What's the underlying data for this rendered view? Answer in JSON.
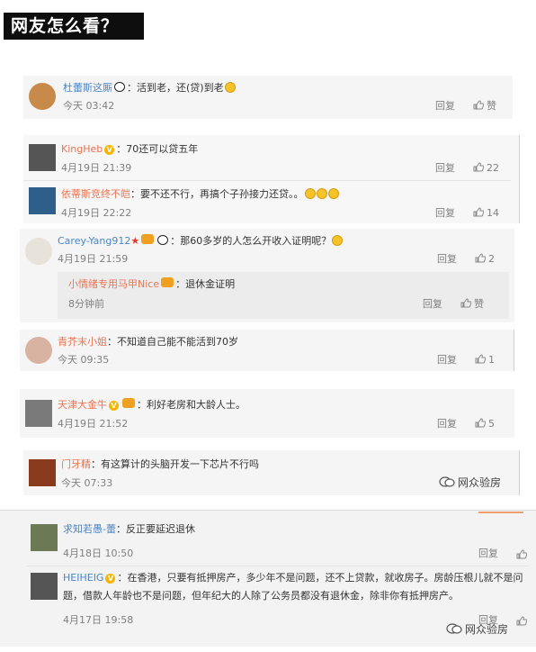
{
  "header": {
    "title": "网友怎么看？"
  },
  "comments": [
    {
      "user": "杜蕾斯这厮",
      "text": "：活到老，还(贷)到老",
      "time": "今天 03:42",
      "reply": "回复",
      "likes": "赞"
    },
    {
      "user": "KingHeb",
      "text": "：70还可以贷五年",
      "time": "4月19日 21:39",
      "reply": "回复",
      "likes": "22"
    },
    {
      "user": "依蒂斯竞终不皑",
      "text": "：要不还不行，再搞个子孙接力还贷。。",
      "time": "4月19日 22:22",
      "reply": "回复",
      "likes": "14"
    },
    {
      "user": "Carey-Yang912",
      "text": "：那60多岁的人怎么开收入证明呢？",
      "time": "4月19日 21:59",
      "reply": "回复",
      "likes": "2"
    },
    {
      "user": "小情绪专用马甲Nice",
      "text": "：退休金证明",
      "time": "8分钟前",
      "reply": "回复",
      "likes": "赞"
    },
    {
      "user": "青芥末小姐",
      "text": "：不知道自己能不能活到70岁",
      "time": "今天 09:35",
      "reply": "回复",
      "likes": "1"
    },
    {
      "user": "天津大金牛",
      "text": "：利好老房和大龄人士。",
      "time": "4月19日 21:52",
      "reply": "回复",
      "likes": "5"
    },
    {
      "user": "门牙精",
      "text": "：有这算计的头脑开发一下芯片不行吗",
      "time": "今天 07:33"
    },
    {
      "user": "求知若愚-蕾",
      "text": "：反正要延迟退休",
      "time": "4月18日 10:50",
      "reply": "回复"
    },
    {
      "user": "HEIHEIG",
      "text_line1": "：在香港，只要有抵押房产，多少年不是问题，还不上贷款，就收房子。房龄压根儿就不是问",
      "text_line2": "题，借款人年龄也不是问题，但年纪大的人除了公务员都没有退休金，除非你有抵押房产。",
      "time": "4月17日 19:58",
      "reply": "回复"
    }
  ],
  "watermark": {
    "text": "网众验房"
  },
  "icons": {
    "like": "thumb-up-icon",
    "verified": "v-badge-icon",
    "emoji": "laugh-emoji-icon"
  }
}
